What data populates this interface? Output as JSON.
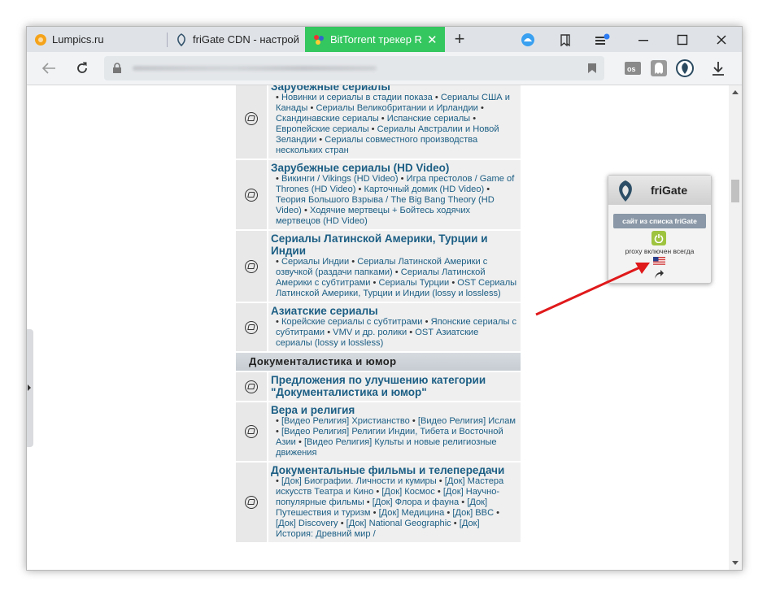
{
  "tabs": [
    {
      "label": "Lumpics.ru",
      "icon": "orange-circle-icon"
    },
    {
      "label": "friGate CDN - настрой",
      "icon": "frigate-icon"
    },
    {
      "label": "BitTorrent трекер R",
      "icon": "bittorrent-icon",
      "active": true
    }
  ],
  "forums": [
    {
      "title": "Зарубежные сериалы",
      "subs": [
        "Новинки и сериалы в стадии показа",
        "Сериалы США и Канады",
        "Сериалы Великобритании и Ирландии",
        "Скандинавские сериалы",
        "Испанские сериалы",
        "Европейские сериалы",
        "Сериалы Австралии и Новой Зеландии",
        "Сериалы совместного производства нескольких стран"
      ]
    },
    {
      "title": "Зарубежные сериалы (HD Video)",
      "subs": [
        "Викинги / Vikings (HD Video)",
        "Игра престолов / Game of Thrones (HD Video)",
        "Карточный домик (HD Video)",
        "Теория Большого Взрыва / The Big Bang Theory (HD Video)",
        "Ходячие мертвецы + Бойтесь ходячих мертвецов (HD Video)"
      ]
    },
    {
      "title": "Сериалы Латинской Америки, Турции и Индии",
      "subs": [
        "Сериалы Индии",
        "Сериалы Латинской Америки с озвучкой (раздачи папками)",
        "Сериалы Латинской Америки с субтитрами",
        "Сериалы Турции",
        "OST Сериалы Латинской Америки, Турции и Индии (lossy и lossless)"
      ]
    },
    {
      "title": "Азиатские сериалы",
      "subs": [
        "Корейские сериалы с субтитрами",
        "Японские сериалы с субтитрами",
        "VMV и др. ролики",
        "OST Азиатские сериалы (lossy и lossless)"
      ]
    }
  ],
  "category": "Документалистика и юмор",
  "forums2": [
    {
      "title": "Предложения по улучшению категории \"Документалистика и юмор\"",
      "subs": []
    },
    {
      "title": "Вера и религия",
      "subs": [
        "[Видео Религия] Христианство",
        "[Видео Религия] Ислам",
        "[Видео Религия] Религии Индии, Тибета и Восточной Азии",
        "[Видео Религия] Культы и новые религиозные движения"
      ]
    },
    {
      "title": "Документальные фильмы и телепередачи",
      "subs": [
        "[Док] Биографии. Личности и кумиры",
        "[Док] Мастера искусств Театра и Кино",
        "[Док] Космос",
        "[Док] Научно-популярные фильмы",
        "[Док] Флора и фауна",
        "[Док] Путешествия и туризм",
        "[Док] Медицина",
        "[Док] BBC",
        "[Док] Discovery",
        "[Док] National Geographic",
        "[Док] История: Древний мир /"
      ]
    }
  ],
  "frigate": {
    "title": "friGate",
    "button": "сайт из списка friGate",
    "status": "proxy включен всегда"
  },
  "colors": {
    "active_tab": "#34c65f",
    "link": "#1b5e84",
    "arrow": "#e0191b"
  }
}
